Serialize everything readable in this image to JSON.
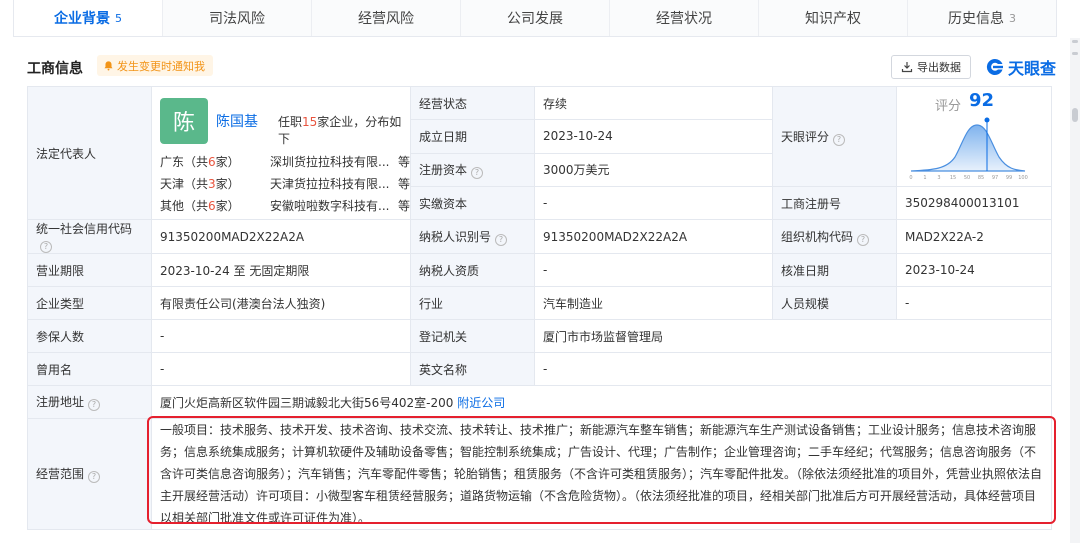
{
  "tabs": [
    {
      "label": "企业背景",
      "count": "5",
      "active": true
    },
    {
      "label": "司法风险",
      "count": ""
    },
    {
      "label": "经营风险",
      "count": ""
    },
    {
      "label": "公司发展",
      "count": ""
    },
    {
      "label": "经营状况",
      "count": ""
    },
    {
      "label": "知识产权",
      "count": ""
    },
    {
      "label": "历史信息",
      "count": "3"
    }
  ],
  "section": {
    "title": "工商信息",
    "notice": "发生变更时通知我",
    "export_label": "导出数据",
    "brand": "天眼查"
  },
  "legal_rep": {
    "label": "法定代表人",
    "avatar_char": "陈",
    "name": "陈国基",
    "desc_prefix": "任职",
    "desc_count": "15",
    "desc_suffix": "家企业，分布如下",
    "regions": [
      {
        "region_pre": "广东（共",
        "count": "6",
        "region_post": "家）",
        "company": "深圳货拉拉科技有限...",
        "etc": "等"
      },
      {
        "region_pre": "天津（共",
        "count": "3",
        "region_post": "家）",
        "company": "天津货拉拉科技有限...",
        "etc": "等"
      },
      {
        "region_pre": "其他（共",
        "count": "6",
        "region_post": "家）",
        "company": "安徽啦啦数字科技有...",
        "etc": "等"
      }
    ]
  },
  "mid_fields": [
    {
      "label": "经营状态",
      "value": "存续",
      "help": false
    },
    {
      "label": "成立日期",
      "value": "2023-10-24",
      "help": false
    },
    {
      "label": "注册资本",
      "value": "3000万美元",
      "help": true
    },
    {
      "label": "实缴资本",
      "value": "-",
      "help": false
    }
  ],
  "score": {
    "label": "天眼评分",
    "score_label": "评分",
    "score_value": "92",
    "axis_ticks": [
      "0",
      "1",
      "3",
      "15",
      "50",
      "85",
      "97",
      "99",
      "100"
    ]
  },
  "reg_no": {
    "label": "工商注册号",
    "value": "350298400013101"
  },
  "rows": [
    [
      {
        "label": "统一社会信用代码",
        "help": true,
        "value": "91350200MAD2X22A2A"
      },
      {
        "label": "纳税人识别号",
        "help": true,
        "value": "91350200MAD2X22A2A"
      },
      {
        "label": "组织机构代码",
        "help": true,
        "value": "MAD2X22A-2"
      }
    ],
    [
      {
        "label": "营业期限",
        "help": false,
        "value": "2023-10-24 至 无固定期限"
      },
      {
        "label": "纳税人资质",
        "help": false,
        "value": "-"
      },
      {
        "label": "核准日期",
        "help": false,
        "value": "2023-10-24"
      }
    ],
    [
      {
        "label": "企业类型",
        "help": false,
        "value": "有限责任公司(港澳台法人独资)"
      },
      {
        "label": "行业",
        "help": false,
        "value": "汽车制造业"
      },
      {
        "label": "人员规模",
        "help": false,
        "value": "-"
      }
    ],
    [
      {
        "label": "参保人数",
        "help": false,
        "value": "-"
      },
      {
        "label": "登记机关",
        "help": false,
        "value": "厦门市市场监督管理局"
      }
    ],
    [
      {
        "label": "曾用名",
        "help": false,
        "value": "-"
      },
      {
        "label": "英文名称",
        "help": false,
        "value": "-"
      }
    ]
  ],
  "address": {
    "label": "注册地址",
    "value": "厦门火炬高新区软件园三期诚毅北大街56号402室-200",
    "link": "附近公司"
  },
  "scope": {
    "label": "经营范围",
    "text": "一般项目：技术服务、技术开发、技术咨询、技术交流、技术转让、技术推广；新能源汽车整车销售；新能源汽车生产测试设备销售；工业设计服务；信息技术咨询服务；信息系统集成服务；计算机软硬件及辅助设备零售；智能控制系统集成；广告设计、代理；广告制作；企业管理咨询；二手车经纪；代驾服务；信息咨询服务（不含许可类信息咨询服务）；汽车销售；汽车零配件零售；轮胎销售；租赁服务（不含许可类租赁服务）；汽车零配件批发。（除依法须经批准的项目外，凭营业执照依法自主开展经营活动）许可项目：小微型客车租赁经营服务；道路货物运输（不含危险货物）。（依法须经批准的项目，经相关部门批准后方可开展经营活动，具体经营项目以相关部门批准文件或许可证件为准）。"
  },
  "colors": {
    "accent": "#0a6ce4",
    "highlight_box": "#e5202e",
    "count_red": "#e8543e",
    "notice_orange": "#f29418",
    "avatar_green": "#5ab88b"
  }
}
